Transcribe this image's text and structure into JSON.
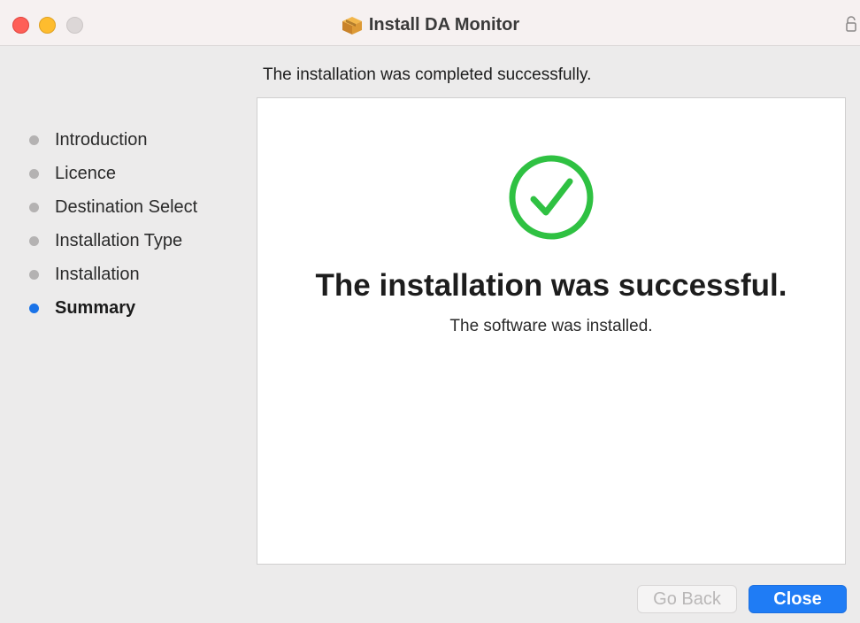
{
  "window": {
    "title": "Install DA Monitor",
    "title_icon": "package-box-icon",
    "lock_icon": "lock-icon"
  },
  "header": {
    "subtitle": "The installation was completed successfully."
  },
  "sidebar": {
    "steps": [
      {
        "label": "Introduction",
        "active": false
      },
      {
        "label": "Licence",
        "active": false
      },
      {
        "label": "Destination Select",
        "active": false
      },
      {
        "label": "Installation Type",
        "active": false
      },
      {
        "label": "Installation",
        "active": false
      },
      {
        "label": "Summary",
        "active": true
      }
    ]
  },
  "main": {
    "icon": "check-circle-icon",
    "title": "The installation was successful.",
    "message": "The software was installed."
  },
  "buttons": {
    "back_label": "Go Back",
    "close_label": "Close"
  },
  "colors": {
    "accent": "#1f7cf5",
    "success": "#2fc142",
    "close_dot": "#fe5f57",
    "minimize_dot": "#febc2e"
  }
}
